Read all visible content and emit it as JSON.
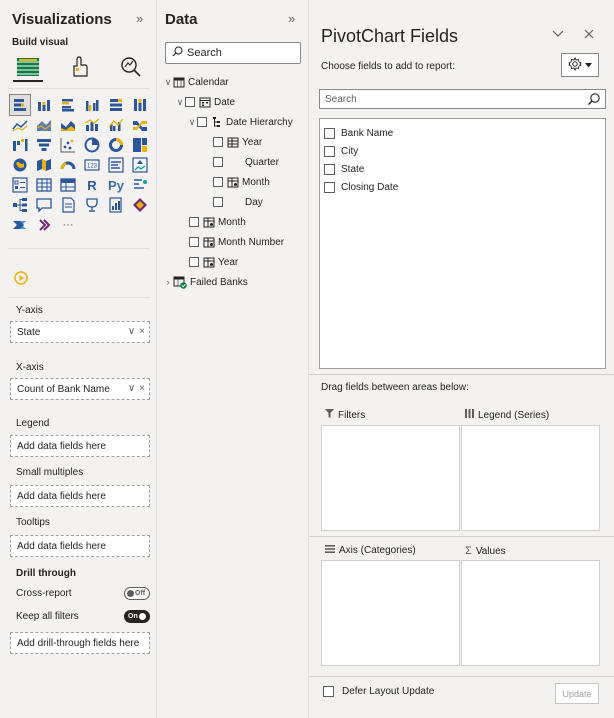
{
  "visualizations": {
    "title": "Visualizations",
    "collapse_glyph": "»",
    "build_visual_label": "Build visual",
    "mode_icons": [
      "build-visual-icon",
      "format-visual-icon",
      "analytics-icon"
    ],
    "viz_types": [
      "stacked-bar-chart-icon",
      "stacked-column-chart-icon",
      "clustered-bar-chart-icon",
      "clustered-column-chart-icon",
      "100-stacked-bar-chart-icon",
      "100-stacked-column-chart-icon",
      "line-chart-icon",
      "area-chart-icon",
      "stacked-area-chart-icon",
      "line-and-stacked-column-chart-icon",
      "line-and-clustered-column-chart-icon",
      "ribbon-chart-icon",
      "waterfall-chart-icon",
      "funnel-chart-icon",
      "scatter-chart-icon",
      "pie-chart-icon",
      "donut-chart-icon",
      "treemap-icon",
      "map-icon",
      "filled-map-icon",
      "gauge-icon",
      "card-icon",
      "multi-row-card-icon",
      "kpi-icon",
      "slicer-icon",
      "table-icon",
      "matrix-icon",
      "r-script-visual-icon",
      "python-visual-icon",
      "key-influencers-icon",
      "decomposition-tree-icon",
      "qa-icon",
      "narrative-icon",
      "goals-icon",
      "paginated-report-icon",
      "power-apps-icon",
      "power-automate-icon",
      "more-visuals-icon",
      "ellipsis-icon"
    ],
    "r_label": "R",
    "py_label": "Py",
    "ellipsis": "···",
    "wells": {
      "y_axis_label": "Y-axis",
      "y_axis_field": "State",
      "x_axis_label": "X-axis",
      "x_axis_field": "Count of Bank Name",
      "legend_label": "Legend",
      "legend_placeholder": "Add data fields here",
      "small_multiples_label": "Small multiples",
      "small_multiples_placeholder": "Add data fields here",
      "tooltips_label": "Tooltips",
      "tooltips_placeholder": "Add data fields here",
      "drill_through_label": "Drill through",
      "cross_report_label": "Cross-report",
      "cross_report_state": "Off",
      "keep_filters_label": "Keep all filters",
      "keep_filters_state": "On",
      "drillthrough_placeholder": "Add drill-through fields here"
    },
    "field_controls": {
      "chevron": "∨",
      "remove": "×"
    }
  },
  "data_pane": {
    "title": "Data",
    "collapse_glyph": "»",
    "search_placeholder": "Search",
    "tree": {
      "calendar": "Calendar",
      "date": "Date",
      "date_hierarchy": "Date Hierarchy",
      "year_h": "Year",
      "quarter": "Quarter",
      "month_h": "Month",
      "day": "Day",
      "month": "Month",
      "month_number": "Month Number",
      "year": "Year",
      "failed_banks": "Failed Banks"
    }
  },
  "pivot": {
    "title": "PivotChart Fields",
    "choose_label": "Choose fields to add to report:",
    "search_placeholder": "Search",
    "fields": [
      "Bank Name",
      "City",
      "State",
      "Closing Date"
    ],
    "drag_label": "Drag fields between areas below:",
    "areas": {
      "filters": "Filters",
      "legend": "Legend (Series)",
      "axis": "Axis (Categories)",
      "values": "Values"
    },
    "defer_label": "Defer Layout Update",
    "update_label": "Update"
  },
  "colors": {
    "pane_bg": "#f3f2f1",
    "accent_yellow": "#e8b10e",
    "chart_blue": "#2b579a",
    "chart_teal": "#00a99d"
  }
}
